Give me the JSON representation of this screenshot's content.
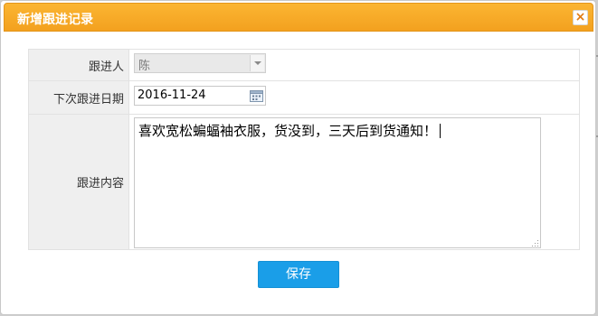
{
  "dialog": {
    "title": "新增跟进记录",
    "close_label": "×"
  },
  "form": {
    "follower": {
      "label": "跟进人",
      "value": "陈"
    },
    "next_date": {
      "label": "下次跟进日期",
      "value": "2016-11-24"
    },
    "content": {
      "label": "跟进内容",
      "value": "喜欢宽松蝙蝠袖衣服，货没到，三天后到货通知！"
    }
  },
  "actions": {
    "save_label": "保存"
  },
  "colors": {
    "title_bar": "#f5a623",
    "primary_button": "#1a9ee8",
    "label_bg": "#efefef"
  }
}
